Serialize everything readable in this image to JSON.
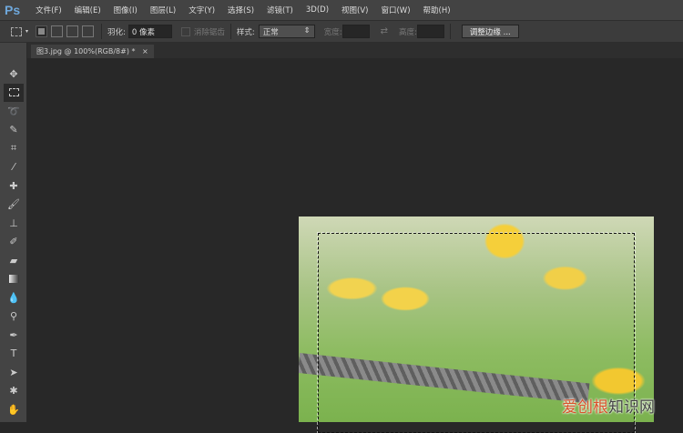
{
  "app": {
    "logo": "Ps"
  },
  "menu": [
    "文件(F)",
    "编辑(E)",
    "图像(I)",
    "图层(L)",
    "文字(Y)",
    "选择(S)",
    "滤镜(T)",
    "3D(D)",
    "视图(V)",
    "窗口(W)",
    "帮助(H)"
  ],
  "options": {
    "feather_label": "羽化:",
    "feather_value": "0 像素",
    "antialias_label": "消除锯齿",
    "style_label": "样式:",
    "style_value": "正常",
    "width_label": "宽度:",
    "height_label": "高度:",
    "refine_edge": "调整边缘 ..."
  },
  "document": {
    "tab_title": "图3.jpg @ 100%(RGB/8#) *",
    "close": "×"
  },
  "tools": [
    "move",
    "rectangular-marquee",
    "lasso",
    "quick-selection",
    "crop",
    "eyedropper",
    "spot-healing",
    "brush",
    "clone-stamp",
    "history-brush",
    "eraser",
    "gradient",
    "blur",
    "dodge",
    "pen",
    "type",
    "path-selection",
    "shape",
    "hand"
  ],
  "watermark": {
    "part1": "爱创根",
    "part2": "知识网"
  }
}
